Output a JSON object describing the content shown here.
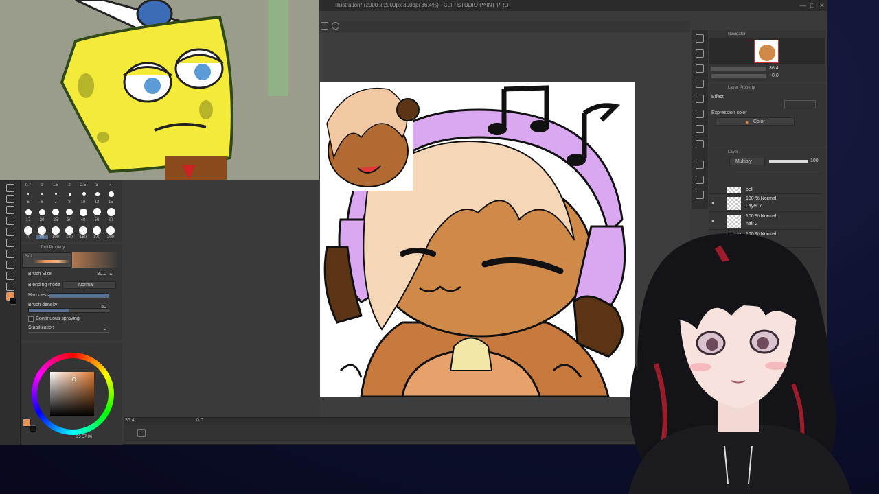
{
  "window": {
    "title": "Illustration* (2000 x 2000px 300dpi 36.4%) - CLIP STUDIO PAINT PRO",
    "minimize": "—",
    "maximize": "□",
    "close": "✕"
  },
  "brush_sizes": {
    "row1_labels": [
      "0.7",
      "1",
      "1.5",
      "2",
      "2.5",
      "3",
      "4"
    ],
    "row2_labels": [
      "5",
      "6",
      "7",
      "8",
      "10",
      "12",
      "15"
    ],
    "row3_labels": [
      "17",
      "20",
      "25",
      "30",
      "40",
      "50",
      "60"
    ],
    "row4_labels": [
      "70",
      "80",
      "100",
      "120",
      "150",
      "170",
      "200"
    ]
  },
  "tool_property": {
    "tab_label": "Tool Property",
    "brush_name": "Soft",
    "brush_size_label": "Brush Size",
    "brush_size_value": "80.0",
    "blending_mode_label": "Blending mode",
    "blending_mode_value": "Normal",
    "hardness_label": "Hardness",
    "brush_density_label": "Brush density",
    "brush_density_value": "50",
    "continuous_spraying_label": "Continuous spraying",
    "stabilization_label": "Stabilization",
    "stabilization_value": "0"
  },
  "color_readout": {
    "values": "25  57  86"
  },
  "canvas_status": {
    "zoom": "36.4",
    "angle": "0.0"
  },
  "navigator": {
    "tab_label": "Navigator",
    "zoom_value": "36.4",
    "rotate_value": "0.0"
  },
  "layer_property": {
    "tab_label": "Layer Property",
    "effect_label": "Effect",
    "expression_color_label": "Expression color",
    "expression_color_value": "Color"
  },
  "layer_panel": {
    "tab_label": "Layer",
    "blend_mode": "Multiply",
    "opacity": "100",
    "layers": [
      {
        "mode": "",
        "name": "bell"
      },
      {
        "mode": "100 % Normal",
        "name": "Layer 7"
      },
      {
        "mode": "100 % Normal",
        "name": "hair 2"
      },
      {
        "mode": "100 % Normal",
        "name": ""
      }
    ]
  },
  "colors": {
    "accent_orange": "#e8955a",
    "panel_bg": "#353535",
    "slider_blue": "#58708f",
    "hair_pink": "#d9a8f0"
  }
}
